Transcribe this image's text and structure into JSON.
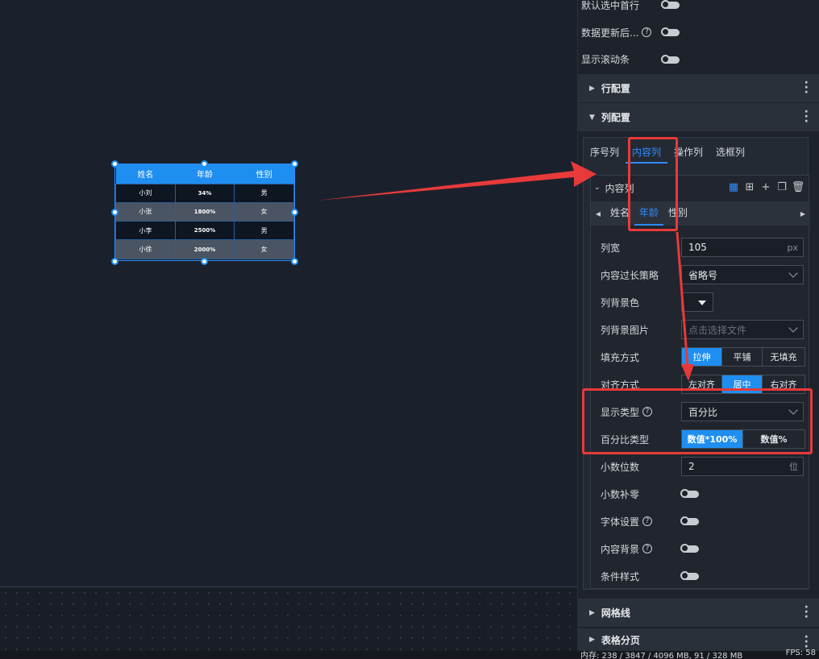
{
  "colors": {
    "accent": "#1f8ef1",
    "highlight": "#e83a3a",
    "panel": "#1e232b"
  },
  "widget": {
    "headers": [
      "姓名",
      "年龄",
      "性别"
    ],
    "rows": [
      [
        "小刘",
        "34%",
        "男"
      ],
      [
        "小张",
        "1800%",
        "女"
      ],
      [
        "小李",
        "2500%",
        "男"
      ],
      [
        "小徐",
        "2000%",
        "女"
      ]
    ]
  },
  "panel": {
    "top_rows": [
      {
        "label": "默认选中首行"
      },
      {
        "label": "数据更新后..."
      },
      {
        "label": "显示滚动条"
      }
    ],
    "sections": {
      "row_config": "行配置",
      "col_config": "列配置",
      "grid_lines": "网格线",
      "pagination": "表格分页"
    },
    "col_tabs": [
      "序号列",
      "内容列",
      "操作列",
      "选框列"
    ],
    "content_col": {
      "title": "内容列",
      "columns": [
        "姓名",
        "年龄",
        "性别"
      ],
      "fields": {
        "width_label": "列宽",
        "width_value": "105",
        "width_unit": "px",
        "overflow_label": "内容过长策略",
        "overflow_value": "省略号",
        "bg_color_label": "列背景色",
        "bg_image_label": "列背景图片",
        "bg_image_placeholder": "点击选择文件",
        "fill_label": "填充方式",
        "fill_options": [
          "拉伸",
          "平铺",
          "无填充"
        ],
        "align_label": "对齐方式",
        "align_options": [
          "左对齐",
          "居中",
          "右对齐"
        ],
        "display_type_label": "显示类型",
        "display_type_value": "百分比",
        "pct_type_label": "百分比类型",
        "pct_options": [
          "数值*100%",
          "数值%"
        ],
        "decimals_label": "小数位数",
        "decimals_value": "2",
        "decimals_unit": "位",
        "pad_zero_label": "小数补零",
        "font_label": "字体设置",
        "content_bg_label": "内容背景",
        "cond_style_label": "条件样式"
      }
    }
  },
  "status": {
    "memory": "内存: 238 / 3847 / 4096 MB, 91 / 328 MB",
    "fps": "FPS: 58"
  }
}
